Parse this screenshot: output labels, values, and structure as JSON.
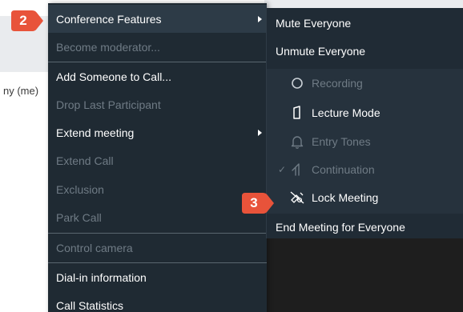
{
  "background": {
    "participant_name": "ny (me)"
  },
  "primary_menu": {
    "items": [
      {
        "label": "Conference Features",
        "enabled": true,
        "has_submenu": true
      },
      {
        "label": "Become moderator...",
        "enabled": false
      },
      {
        "label": "Add Someone to Call...",
        "enabled": true
      },
      {
        "label": "Drop Last Participant",
        "enabled": false
      },
      {
        "label": "Extend meeting",
        "enabled": true,
        "has_submenu": true
      },
      {
        "label": "Extend Call",
        "enabled": false
      },
      {
        "label": "Exclusion",
        "enabled": false
      },
      {
        "label": "Park Call",
        "enabled": false
      },
      {
        "label": "Control camera",
        "enabled": false
      },
      {
        "label": "Dial-in information",
        "enabled": true
      },
      {
        "label": "Call Statistics",
        "enabled": true
      }
    ]
  },
  "submenu": {
    "items": [
      {
        "label": "Mute Everyone",
        "enabled": true
      },
      {
        "label": "Unmute Everyone",
        "enabled": true
      },
      {
        "label": "Recording",
        "enabled": false,
        "icon": "record-circle-icon"
      },
      {
        "label": "Lecture Mode",
        "enabled": true,
        "icon": "lecture-icon"
      },
      {
        "label": "Entry Tones",
        "enabled": false,
        "icon": "bell-icon"
      },
      {
        "label": "Continuation",
        "enabled": false,
        "checked": true,
        "icon": "continuation-icon"
      },
      {
        "label": "Lock Meeting",
        "enabled": true,
        "icon": "lock-meeting-icon"
      },
      {
        "label": "End Meeting for Everyone",
        "enabled": true
      }
    ],
    "check_mark": "✓"
  },
  "callouts": [
    {
      "number": "2"
    },
    {
      "number": "3"
    }
  ],
  "colors": {
    "menu_bg": "#1f2a33",
    "disabled_text": "#6f7b85",
    "callout": "#e8533a"
  }
}
